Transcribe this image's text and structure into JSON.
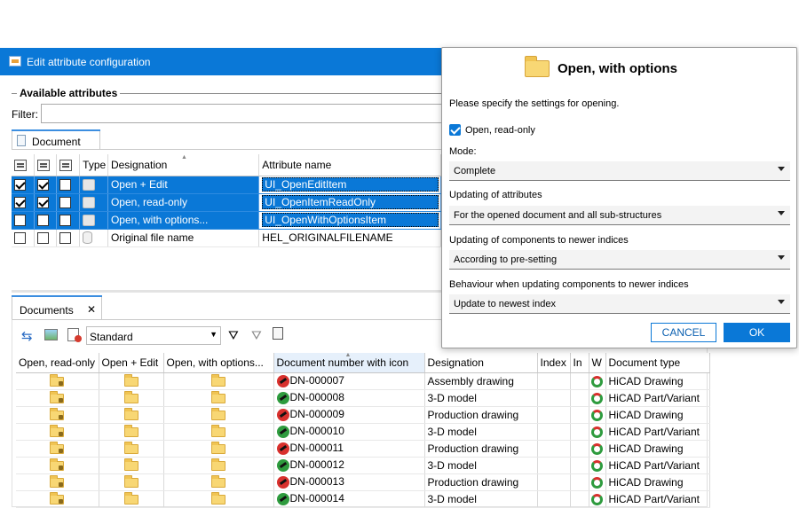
{
  "attr_window": {
    "title": "Edit attribute configuration",
    "section_label": "Available attributes",
    "filter_label": "Filter:",
    "tab_label": "Document",
    "columns": [
      "Type",
      "Designation",
      "Attribute name"
    ],
    "rows": [
      {
        "c1": true,
        "c2": true,
        "c3": false,
        "designation": "Open + Edit",
        "attribute": "UI_OpenEditItem",
        "selected": true
      },
      {
        "c1": true,
        "c2": true,
        "c3": false,
        "designation": "Open, read-only",
        "attribute": "UI_OpenItemReadOnly",
        "selected": true
      },
      {
        "c1": false,
        "c2": false,
        "c3": false,
        "designation": "Open, with options...",
        "attribute": "UI_OpenWithOptionsItem",
        "selected": true
      },
      {
        "c1": false,
        "c2": false,
        "c3": false,
        "designation": "Original file name",
        "attribute": "HEL_ORIGINALFILENAME",
        "selected": false
      }
    ]
  },
  "documents": {
    "tab_label": "Documents",
    "close_glyph": "✕",
    "view_value": "Standard",
    "columns": [
      "Open, read-only",
      "Open + Edit",
      "Open, with options...",
      "Document number with icon",
      "Designation",
      "Index",
      "In",
      "W",
      "Document type"
    ],
    "rows": [
      {
        "number": "DN-000007",
        "designation": "Assembly drawing",
        "type": "HiCAD Drawing",
        "icon": "red"
      },
      {
        "number": "DN-000008",
        "designation": "3-D model",
        "type": "HiCAD Part/Variant",
        "icon": "green"
      },
      {
        "number": "DN-000009",
        "designation": "Production drawing",
        "type": "HiCAD Drawing",
        "icon": "red"
      },
      {
        "number": "DN-000010",
        "designation": "3-D model",
        "type": "HiCAD Part/Variant",
        "icon": "green"
      },
      {
        "number": "DN-000011",
        "designation": "Production drawing",
        "type": "HiCAD Drawing",
        "icon": "red"
      },
      {
        "number": "DN-000012",
        "designation": "3-D model",
        "type": "HiCAD Part/Variant",
        "icon": "green"
      },
      {
        "number": "DN-000013",
        "designation": "Production drawing",
        "type": "HiCAD Drawing",
        "icon": "red"
      },
      {
        "number": "DN-000014",
        "designation": "3-D model",
        "type": "HiCAD Part/Variant",
        "icon": "green"
      }
    ]
  },
  "dialog": {
    "title": "Open, with options",
    "intro": "Please specify the settings for opening.",
    "readonly_label": "Open, read-only",
    "readonly_checked": true,
    "mode_label": "Mode:",
    "mode_value": "Complete",
    "attr_update_label": "Updating of attributes",
    "attr_update_value": "For the opened document and all sub-structures",
    "comp_update_label": "Updating of components to newer indices",
    "comp_update_value": "According to pre-setting",
    "behaviour_label": "Behaviour when updating components to newer indices",
    "behaviour_value": "Update to newest index",
    "cancel_label": "CANCEL",
    "ok_label": "OK"
  },
  "colors": {
    "accent": "#0a78d7",
    "selection": "#0a78d7",
    "folder": "#f8d774",
    "icon_red": "#d8302d",
    "icon_green": "#2e9b3e"
  }
}
